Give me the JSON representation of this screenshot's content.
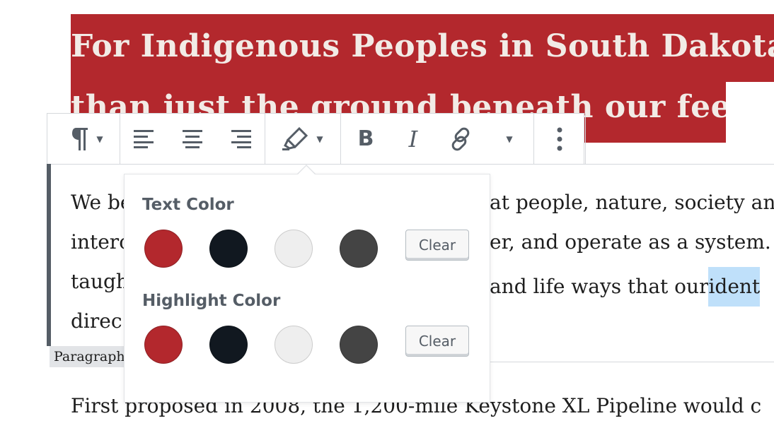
{
  "heading": {
    "line1": "For Indigenous Peoples in South Dakota, t",
    "line2": "than just the ground beneath our feet."
  },
  "toolbar": {
    "paragraph_icon": "pilcrow-icon",
    "align_left_icon": "align-left-icon",
    "align_center_icon": "align-center-icon",
    "align_right_icon": "align-right-icon",
    "color_icon": "highlighter-icon",
    "bold_label": "B",
    "italic_label": "I",
    "link_icon": "link-icon",
    "more_icon": "more-vertical-icon"
  },
  "paragraph": {
    "line1_start": "We be",
    "line1_end": "at people, nature, society an",
    "line2_start": "interc",
    "line2_end": "er, and operate as a system. C",
    "line3_start": "taugh",
    "line3_mid": "and life ways that our ",
    "line3_selected": "ident",
    "line4_start": "direc",
    "next": "First proposed in 2008, the 1,200-mile Keystone XL Pipeline would c"
  },
  "block_label": "Paragraph",
  "popover": {
    "text_color_title": "Text Color",
    "highlight_color_title": "Highlight Color",
    "clear_label": "Clear",
    "colors": [
      "#b3282d",
      "#111820",
      "#eeeeee",
      "#444444"
    ]
  }
}
